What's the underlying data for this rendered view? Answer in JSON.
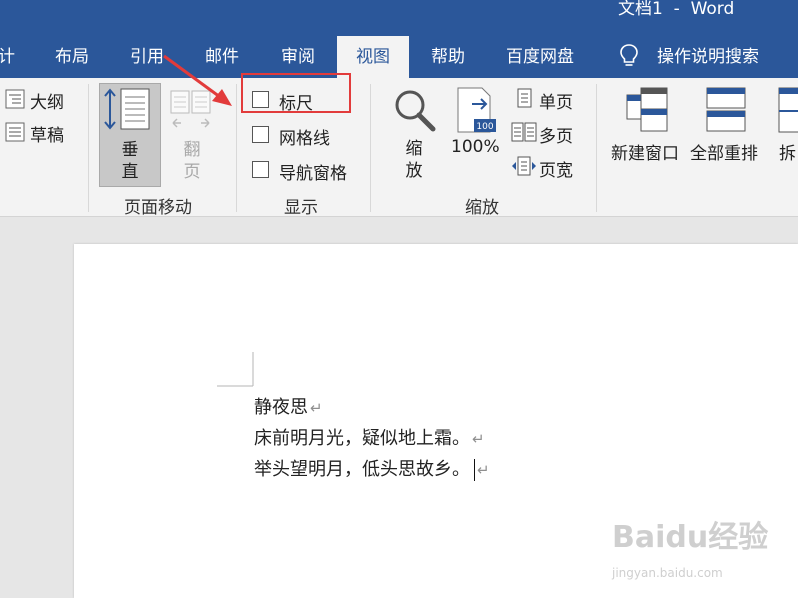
{
  "window": {
    "title": "文档1  -  Word"
  },
  "tabs": [
    {
      "label": "计"
    },
    {
      "label": "布局"
    },
    {
      "label": "引用"
    },
    {
      "label": "邮件"
    },
    {
      "label": "审阅"
    },
    {
      "label": "视图"
    },
    {
      "label": "帮助"
    },
    {
      "label": "百度网盘"
    },
    {
      "label": "操作说明搜索"
    }
  ],
  "ribbon": {
    "views": {
      "outline": "大纲",
      "draft": "草稿"
    },
    "page_movement": {
      "vertical": [
        "垂",
        "直"
      ],
      "side_to_side": [
        "翻",
        "页"
      ],
      "group_label": "页面移动"
    },
    "show": {
      "ruler": "标尺",
      "gridlines": "网格线",
      "navigation_pane": "导航窗格",
      "group_label": "显示",
      "ruler_checked": false
    },
    "zoom": {
      "zoom_btn": [
        "缩",
        "放"
      ],
      "hundred": "100%",
      "single_page": "单页",
      "multiple_pages": "多页",
      "page_width": "页宽",
      "group_label": "缩放"
    },
    "window": {
      "new_window": "新建窗口",
      "arrange_all": "全部重排",
      "split": "拆"
    }
  },
  "document": {
    "lines": [
      "静夜思",
      "床前明月光，疑似地上霜。",
      "举头望明月，低头思故乡。"
    ],
    "paragraph_mark": "↵"
  },
  "watermark": {
    "brand": "Baidu经验",
    "url": "jingyan.baidu.com"
  },
  "colors": {
    "word_blue": "#2b579a",
    "ribbon_bg": "#f3f3f3",
    "callout_red": "#e23b3b"
  }
}
